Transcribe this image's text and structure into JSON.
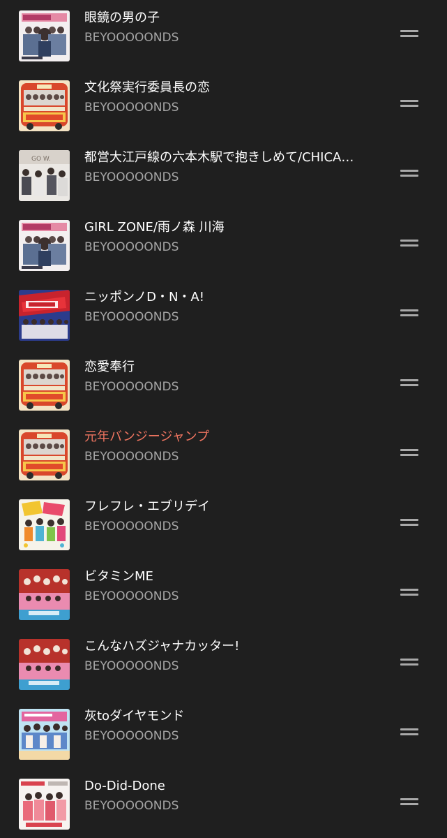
{
  "queue": {
    "playing_color": "#f07560",
    "items": [
      {
        "title": "眼鏡の男の子",
        "artist": "BEYOOOOONDS",
        "art": "megane-no-otokonoko-cover",
        "playing": false
      },
      {
        "title": "文化祭実行委員長の恋",
        "artist": "BEYOOOOONDS",
        "art": "bus-album-cover",
        "playing": false
      },
      {
        "title": "都営大江戸線の六本木駅で抱きしめて/CHICA…",
        "artist": "BEYOOOOONDS",
        "art": "go-waist-cover",
        "playing": false
      },
      {
        "title": "GIRL ZONE/雨ノ森 川海",
        "artist": "BEYOOOOONDS",
        "art": "megane-no-otokonoko-cover",
        "playing": false
      },
      {
        "title": "ニッポンノD・N・A!",
        "artist": "BEYOOOOONDS",
        "art": "dna-cover",
        "playing": false
      },
      {
        "title": "恋愛奉行",
        "artist": "BEYOOOOONDS",
        "art": "bus-album-cover",
        "playing": false
      },
      {
        "title": "元年バンジージャンプ",
        "artist": "BEYOOOOONDS",
        "art": "bus-album-cover",
        "playing": true
      },
      {
        "title": "フレフレ・エブリデイ",
        "artist": "BEYOOOOONDS",
        "art": "flag-cover",
        "playing": false
      },
      {
        "title": "ビタミンME",
        "artist": "BEYOOOOONDS",
        "art": "vitamin-me-cover",
        "playing": false
      },
      {
        "title": "こんなハズジャナカッター!",
        "artist": "BEYOOOOONDS",
        "art": "vitamin-me-cover",
        "playing": false
      },
      {
        "title": "灰toダイヤモンド",
        "artist": "BEYOOOOONDS",
        "art": "summer-cover",
        "playing": false
      },
      {
        "title": "Do-Did-Done",
        "artist": "BEYOOOOONDS",
        "art": "do-did-done-cover",
        "playing": false
      }
    ]
  }
}
